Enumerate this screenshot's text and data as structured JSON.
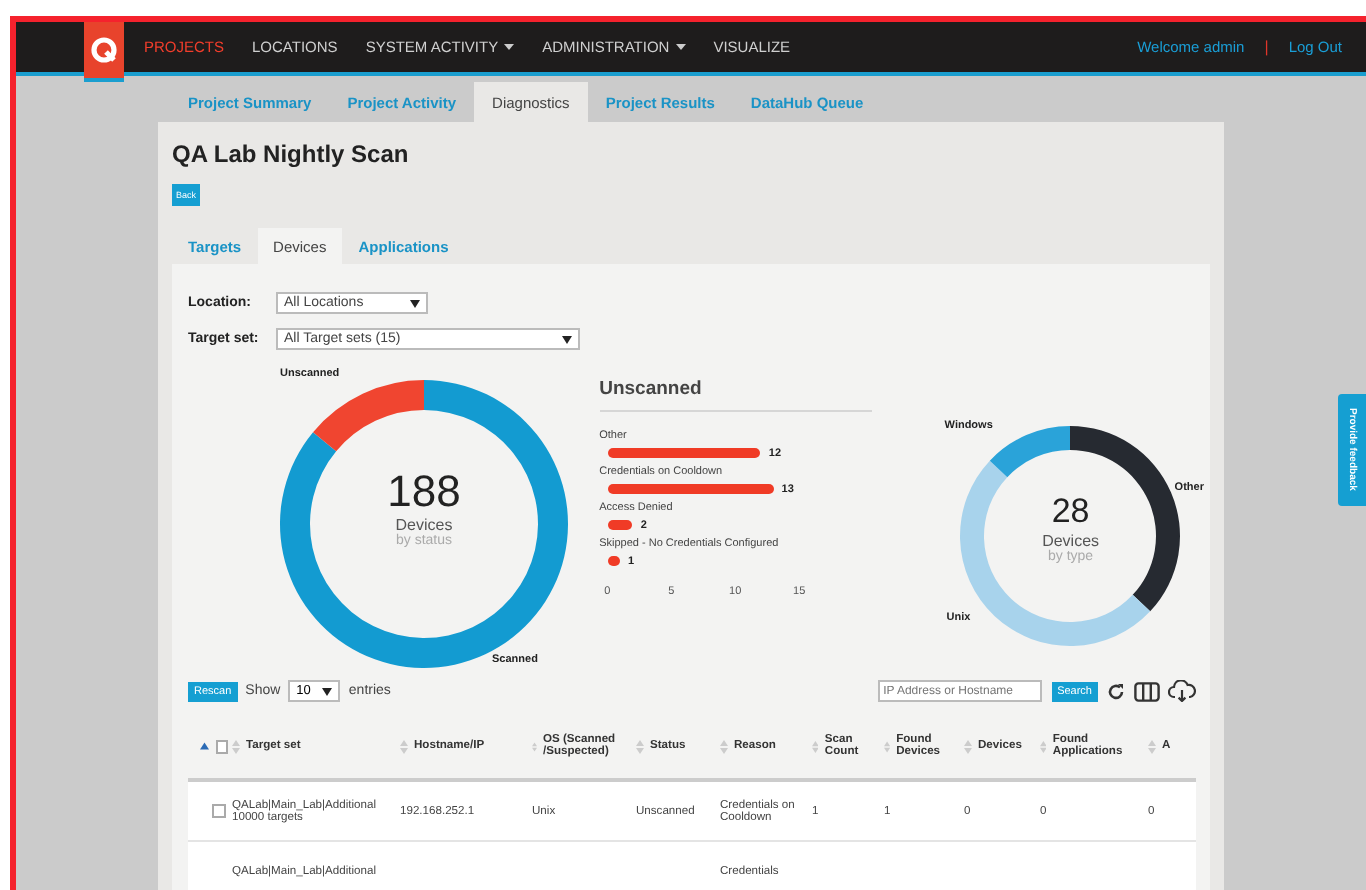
{
  "nav": {
    "items": [
      {
        "label": "PROJECTS",
        "selected": true,
        "dropdown": false
      },
      {
        "label": "LOCATIONS",
        "selected": false,
        "dropdown": false
      },
      {
        "label": "SYSTEM ACTIVITY",
        "selected": false,
        "dropdown": true
      },
      {
        "label": "ADMINISTRATION",
        "selected": false,
        "dropdown": true
      },
      {
        "label": "VISUALIZE",
        "selected": false,
        "dropdown": false
      }
    ],
    "welcome": "Welcome admin",
    "separator": "|",
    "logout": "Log Out"
  },
  "subtabs": [
    {
      "label": "Project Summary",
      "selected": false
    },
    {
      "label": "Project Activity",
      "selected": false
    },
    {
      "label": "Diagnostics",
      "selected": true
    },
    {
      "label": "Project Results",
      "selected": false
    },
    {
      "label": "DataHub Queue",
      "selected": false
    }
  ],
  "title": "QA Lab Nightly Scan",
  "back_button": "Back",
  "tabs": [
    {
      "label": "Targets",
      "selected": false
    },
    {
      "label": "Devices",
      "selected": true
    },
    {
      "label": "Applications",
      "selected": false
    }
  ],
  "filters": [
    {
      "label": "Location:",
      "value": "All Locations",
      "wide": false
    },
    {
      "label": "Target set:",
      "value": "All Target sets (15)",
      "wide": true
    }
  ],
  "status_donut": {
    "total": "188",
    "unit": "Devices",
    "caption": "by status",
    "labels": [
      "Unscanned",
      "Scanned"
    ]
  },
  "unscanned": {
    "title": "Unscanned",
    "chart_data": {
      "type": "bar",
      "orientation": "horizontal",
      "categories": [
        "Other",
        "Credentials on Cooldown",
        "Access Denied",
        "Skipped - No Credentials Configured"
      ],
      "values": [
        12,
        13,
        2,
        1
      ],
      "xlim": [
        0,
        15
      ],
      "xticks": [
        0,
        5,
        10,
        15
      ],
      "data_labels": true
    }
  },
  "type_donut": {
    "total": "28",
    "unit": "Devices",
    "caption": "by type",
    "labels": [
      "Windows",
      "Other",
      "Unix"
    ]
  },
  "table": {
    "rescan_button": "Rescan",
    "show_label": "Show",
    "page_size": "10",
    "entries_label": "entries",
    "search_placeholder": "IP Address or Hostname",
    "search_button": "Search",
    "select_all_checked": false,
    "columns": [
      "Target set",
      "Hostname/IP",
      "OS (Scanned /Suspected)",
      "Status",
      "Reason",
      "Scan Count",
      "Found Devices",
      "Devices",
      "Found Applications",
      "A"
    ],
    "rows": [
      {
        "checked": false,
        "cells": [
          "QALab|Main_Lab|Additional 10000 targets",
          "192.168.252.1",
          "Unix",
          "Unscanned",
          "Credentials on Cooldown",
          "1",
          "1",
          "0",
          "0",
          "0"
        ]
      },
      {
        "cells": [
          "QALab|Main_Lab|Additional",
          "",
          "",
          "",
          "Credentials",
          "",
          "",
          "",
          "",
          ""
        ]
      }
    ]
  },
  "feedback_tab": "Provide feedback"
}
